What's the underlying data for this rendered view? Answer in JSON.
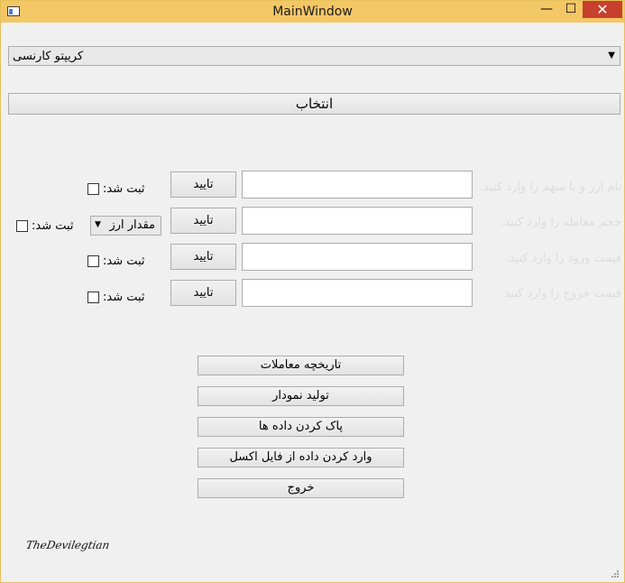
{
  "window": {
    "title": "MainWindow",
    "minimize": "—",
    "maximize": "☐",
    "close": "✕"
  },
  "crypto_combo": {
    "selected": "کریپتو کارنسی",
    "arrow": "▼"
  },
  "select_button": "انتخاب",
  "rows": [
    {
      "prompt": "نام ارز و یا سهم را وارد کنید.",
      "confirm": "تایید",
      "status": "ثبت شد:"
    },
    {
      "prompt": "حجم معامله را وارد کنید.",
      "confirm": "تایید",
      "status": "ثبت شد:"
    },
    {
      "prompt": "قیمت ورود را وارد کنید.",
      "confirm": "تایید",
      "status": "ثبت شد:"
    },
    {
      "prompt": "قیمت خروج  را وارد کنید.",
      "confirm": "تایید",
      "status": "ثبت شد:"
    }
  ],
  "currency_select": {
    "selected": "مقدار ارز",
    "arrow": "▼"
  },
  "menu": {
    "history": "تاریخچه معاملات",
    "chart": "تولید نمودار",
    "clear": "پاک کردن داده ها",
    "import": "وارد کردن داده از فایل اکسل",
    "exit": "خروج"
  },
  "signature": "TheDevilegtian"
}
